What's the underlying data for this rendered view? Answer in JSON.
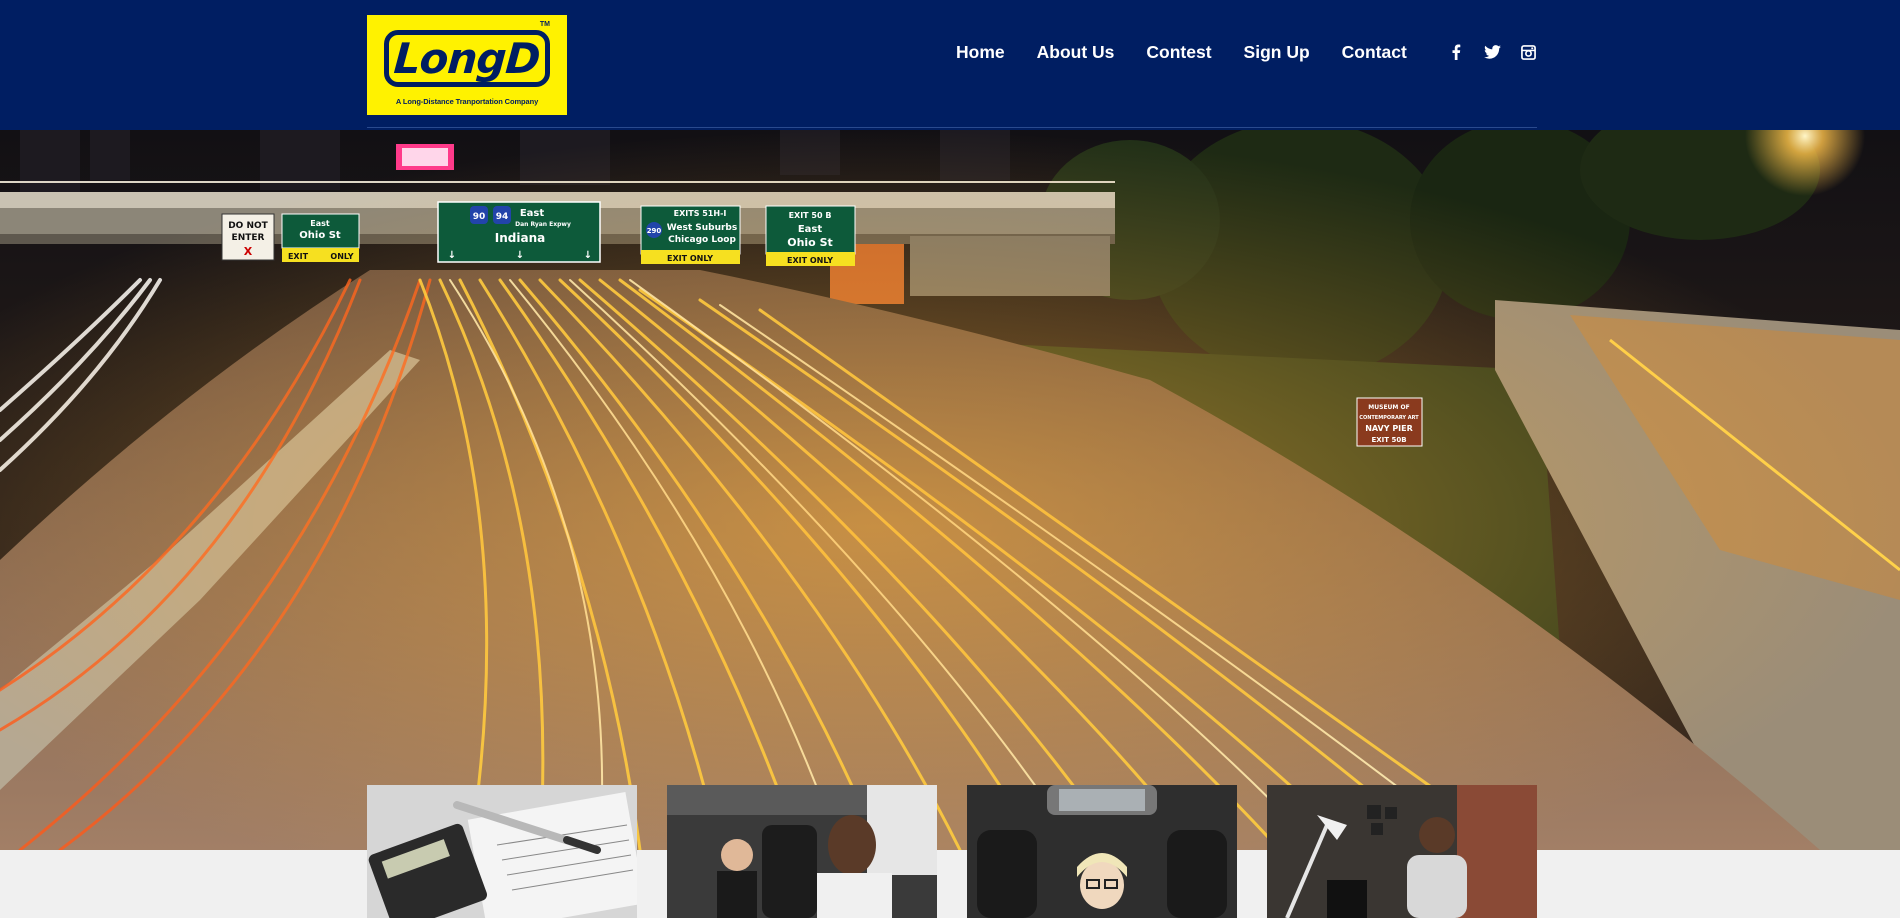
{
  "brand": {
    "name": "LongD",
    "trademark": "TM",
    "tagline": "A Long-Distance Tranportation Company",
    "colors": {
      "navy": "#001e62",
      "yellow": "#fff200"
    }
  },
  "nav": {
    "items": [
      {
        "label": "Home"
      },
      {
        "label": "About Us"
      },
      {
        "label": "Contest"
      },
      {
        "label": "Sign Up"
      },
      {
        "label": "Contact"
      }
    ]
  },
  "social": {
    "icons": [
      "facebook-icon",
      "twitter-icon",
      "instagram-icon"
    ]
  },
  "hero": {
    "image": "night-highway-light-trails",
    "signs": {
      "do_not_enter": [
        "DO NOT",
        "ENTER",
        "X"
      ],
      "ohio_st_left": [
        "East",
        "Ohio St",
        "EXIT",
        "ONLY"
      ],
      "indiana": [
        "90",
        "94",
        "East",
        "Dan Ryan Expwy",
        "Indiana"
      ],
      "exits": [
        "EXITS 51H-I",
        "290",
        "West Suburbs",
        "Chicago Loop",
        "EXIT ONLY"
      ],
      "exit_50b": [
        "EXIT 50 B",
        "East",
        "Ohio St",
        "EXIT ONLY"
      ],
      "museum": [
        "MUSEUM OF",
        "CONTEMPORARY ART",
        "NAVY PIER",
        "EXIT 50B"
      ]
    }
  },
  "cards": [
    {
      "image": "calculator-and-pen-photo"
    },
    {
      "image": "driver-with-passenger-photo"
    },
    {
      "image": "woman-in-car-photo"
    },
    {
      "image": "man-at-desk-photo"
    }
  ]
}
